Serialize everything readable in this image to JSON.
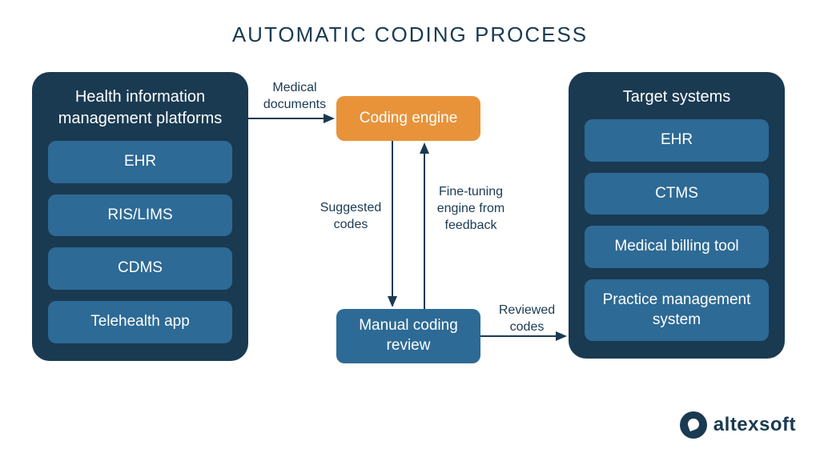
{
  "title": "AUTOMATIC CODING PROCESS",
  "left_panel": {
    "title": "Health information management platforms",
    "items": [
      "EHR",
      "RIS/LIMS",
      "CDMS",
      "Telehealth app"
    ]
  },
  "right_panel": {
    "title": "Target systems",
    "items": [
      "EHR",
      "CTMS",
      "Medical billing tool",
      "Practice management system"
    ]
  },
  "nodes": {
    "coding_engine": "Coding engine",
    "manual_review": "Manual coding review"
  },
  "edges": {
    "medical_documents": "Medical documents",
    "suggested_codes": "Suggested codes",
    "finetune_feedback": "Fine-tuning engine from feedback",
    "reviewed_codes": "Reviewed codes"
  },
  "logo": "altexsoft",
  "colors": {
    "panel": "#1a3a52",
    "pill": "#2d6a95",
    "orange": "#e8933a"
  }
}
